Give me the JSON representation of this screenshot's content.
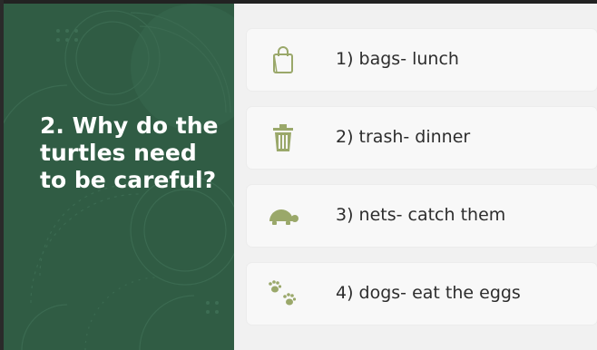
{
  "slide": {
    "question": "2. Why do the turtles need to be careful?",
    "items": [
      {
        "label": "1) bags- lunch",
        "icon": "shopping-bag-icon"
      },
      {
        "label": "2) trash- dinner",
        "icon": "trash-can-icon"
      },
      {
        "label": "3) nets- catch them",
        "icon": "turtle-icon"
      },
      {
        "label": "4) dogs- eat the eggs",
        "icon": "paw-prints-icon"
      }
    ],
    "colors": {
      "panel": "#305c44",
      "icon": "#9aa86a",
      "card": "#f8f8f8",
      "background": "#f1f1f1"
    }
  }
}
